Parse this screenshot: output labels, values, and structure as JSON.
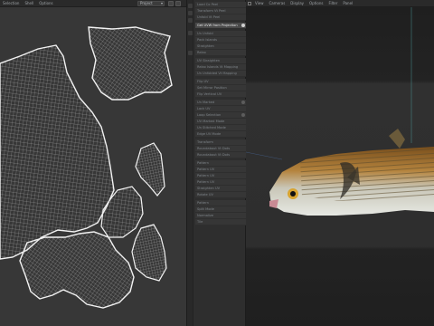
{
  "uv_editor": {
    "menu": [
      "Selection",
      "Shell",
      "Options"
    ],
    "dropdown_value": "Project",
    "colors": {
      "background": "#373737",
      "wire": "#cfcfcf",
      "outline": "#f2f2f2"
    }
  },
  "tool_panel": {
    "groups": [
      [
        "Load Co Peel",
        "Transform Vt Peel",
        "Unfold Vt Peel"
      ],
      [
        "Get UVW from Projection"
      ],
      [
        "Un Unfold",
        "Pack Islands",
        "Straighten",
        "Relax"
      ],
      [
        "UV Straighten",
        "Relax Islands Vt Mapping",
        "Un Unfolded Vt Mapping"
      ],
      [
        "Flip UV",
        "Set Mirror Position",
        "Flip Vertical UV"
      ],
      [
        "Un Marked",
        "Lock UV",
        "Loop Selection",
        "UV Marked Mode",
        "Un Stitched Mode",
        "Edge UV Mode"
      ],
      [
        "Transform",
        "Roundabout Vt Dots",
        "Roundabout Vt Dots"
      ],
      [
        "Pattern",
        "Pattern UV",
        "Pattern UV",
        "Pattern UV",
        "Straighten UV",
        "Rotate UV"
      ],
      [
        "Pattern",
        "Split Mode",
        "Normalize",
        "Tile"
      ]
    ],
    "highlighted": "Get UVW from Projection"
  },
  "viewport": {
    "menu": [
      "View",
      "Cameras",
      "Display",
      "Options",
      "Filter",
      "Panel"
    ],
    "colors": {
      "background": "#232323",
      "fish_back": "#9a6a2a",
      "fish_belly": "#d9dcd6"
    }
  }
}
